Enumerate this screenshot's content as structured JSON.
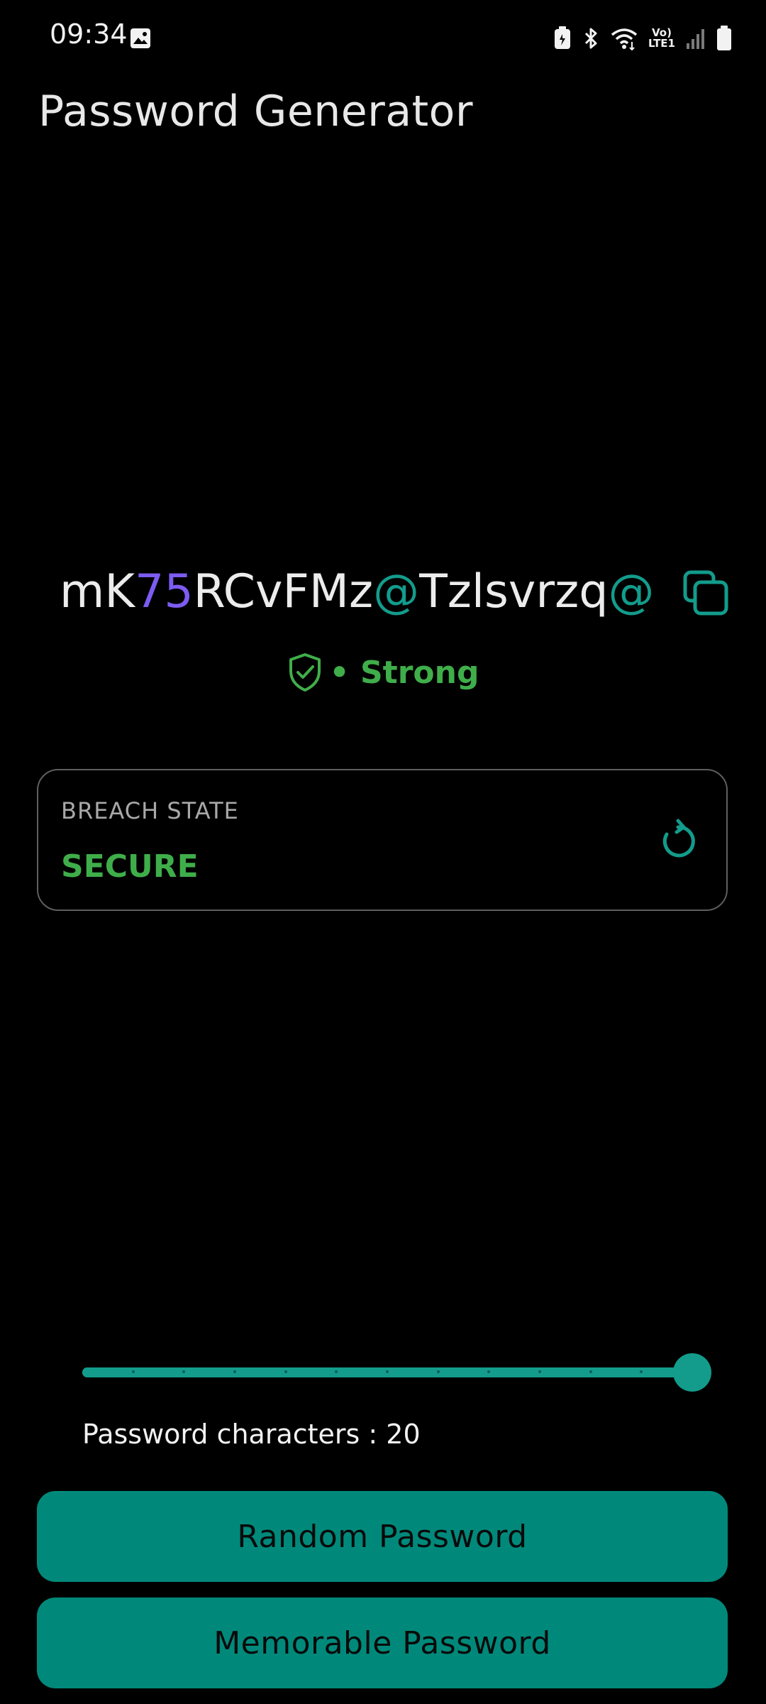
{
  "status_bar": {
    "time": "09:34",
    "network_label_top": "Vo)",
    "network_label_bottom": "LTE1"
  },
  "header": {
    "title": "Password Generator"
  },
  "password": {
    "value": "mK75RCvFMz@Tzlsvrzq@",
    "colors": {
      "letters": "#ececec",
      "digits": "#7c5cf2",
      "symbols": "#139c8c"
    }
  },
  "strength": {
    "label": "• Strong",
    "color": "#3fae4a",
    "icon": "shield-check-icon"
  },
  "breach": {
    "label": "BREACH STATE",
    "value": "SECURE",
    "icon": "refresh-icon"
  },
  "length_slider": {
    "value": 20,
    "max": 20,
    "caption": "Password characters : 20"
  },
  "buttons": {
    "random_label": "Random Password",
    "memorable_label": "Memorable Password",
    "color": "#00897b"
  },
  "accent_color": "#139c8c"
}
